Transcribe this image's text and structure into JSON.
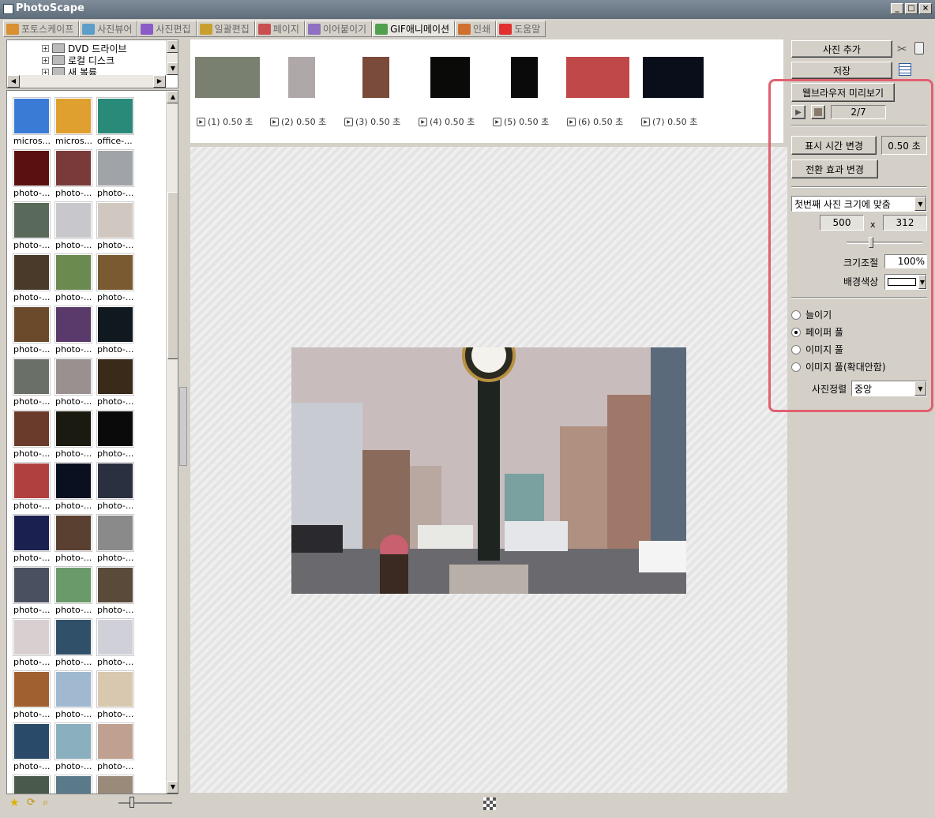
{
  "window": {
    "title": "PhotoScape"
  },
  "tabs": [
    {
      "label": "포토스케이프",
      "color": "#d89030"
    },
    {
      "label": "사진뷰어",
      "color": "#5c9ec8"
    },
    {
      "label": "사진편집",
      "color": "#8a5cc8"
    },
    {
      "label": "일괄편집",
      "color": "#c8a030"
    },
    {
      "label": "페이지",
      "color": "#c85050"
    },
    {
      "label": "이어붙이기",
      "color": "#9070c0"
    },
    {
      "label": "GIF애니메이션",
      "color": "#50a050"
    },
    {
      "label": "인쇄",
      "color": "#d07030"
    },
    {
      "label": "도움말",
      "color": "#e03030"
    }
  ],
  "tree": {
    "items": [
      "DVD 드라이브",
      "로컬 디스크",
      "새 볼륨"
    ]
  },
  "thumbnails": [
    {
      "cap": "micros...",
      "c": "#3a7bd5"
    },
    {
      "cap": "micros...",
      "c": "#e0a030"
    },
    {
      "cap": "office-...",
      "c": "#2a8a7a"
    },
    {
      "cap": "photo-...",
      "c": "#5a1010"
    },
    {
      "cap": "photo-...",
      "c": "#7a3a3a"
    },
    {
      "cap": "photo-...",
      "c": "#a0a4a8"
    },
    {
      "cap": "photo-...",
      "c": "#5a6a5a"
    },
    {
      "cap": "photo-...",
      "c": "#c8c8cc"
    },
    {
      "cap": "photo-...",
      "c": "#d0c8c0"
    },
    {
      "cap": "photo-...",
      "c": "#4a3a2a"
    },
    {
      "cap": "photo-...",
      "c": "#6a8a50"
    },
    {
      "cap": "photo-...",
      "c": "#7a5a30"
    },
    {
      "cap": "photo-...",
      "c": "#6a4a2a"
    },
    {
      "cap": "photo-...",
      "c": "#5a3a6a"
    },
    {
      "cap": "photo-...",
      "c": "#101820"
    },
    {
      "cap": "photo-...",
      "c": "#6a7068"
    },
    {
      "cap": "photo-...",
      "c": "#9a9090"
    },
    {
      "cap": "photo-...",
      "c": "#3a2a1a"
    },
    {
      "cap": "photo-...",
      "c": "#6a3a2a"
    },
    {
      "cap": "photo-...",
      "c": "#1a1a10"
    },
    {
      "cap": "photo-...",
      "c": "#0a0a0a"
    },
    {
      "cap": "photo-...",
      "c": "#b04040"
    },
    {
      "cap": "photo-...",
      "c": "#0a1020"
    },
    {
      "cap": "photo-...",
      "c": "#2a3040"
    },
    {
      "cap": "photo-...",
      "c": "#1a2050"
    },
    {
      "cap": "photo-...",
      "c": "#5a4030"
    },
    {
      "cap": "photo-...",
      "c": "#8a8a8a"
    },
    {
      "cap": "photo-...",
      "c": "#4a5060"
    },
    {
      "cap": "photo-...",
      "c": "#6a9a6a"
    },
    {
      "cap": "photo-...",
      "c": "#5a4a3a"
    },
    {
      "cap": "photo-...",
      "c": "#d8d0d0"
    },
    {
      "cap": "photo-...",
      "c": "#30506a"
    },
    {
      "cap": "photo-...",
      "c": "#d0d0d8"
    },
    {
      "cap": "photo-...",
      "c": "#a06030"
    },
    {
      "cap": "photo-...",
      "c": "#a0b8d0"
    },
    {
      "cap": "photo-...",
      "c": "#d8c8b0"
    },
    {
      "cap": "photo-...",
      "c": "#2a4a6a"
    },
    {
      "cap": "photo-...",
      "c": "#8ab0c0"
    },
    {
      "cap": "photo-...",
      "c": "#c0a090"
    },
    {
      "cap": "",
      "c": "#4a5a4a"
    },
    {
      "cap": "",
      "c": "#5a7a8a"
    },
    {
      "cap": "",
      "c": "#9a8a7a"
    }
  ],
  "frames": [
    {
      "label": "(1) 0.50 초",
      "c": "#7a8070"
    },
    {
      "label": "(2) 0.50 초",
      "c": "#b0a8a8"
    },
    {
      "label": "(3) 0.50 초",
      "c": "#7a4a3a"
    },
    {
      "label": "(4) 0.50 초",
      "c": "#0a0a08"
    },
    {
      "label": "(5) 0.50 초",
      "c": "#0a0a0a"
    },
    {
      "label": "(6) 0.50 초",
      "c": "#c04848"
    },
    {
      "label": "(7) 0.50 초",
      "c": "#0a0e1a"
    }
  ],
  "right_panel": {
    "add_photo": "사진 추가",
    "save": "저장",
    "browser_preview": "웹브라우저 미리보기",
    "frame_counter": "2/7",
    "change_time": "표시 시간 변경",
    "time_value": "0.50 초",
    "change_effect": "전환 효과 변경",
    "size_mode": "첫번째 사진 크기에 맞춤",
    "width": "500",
    "times": "x",
    "height": "312",
    "scale_label": "크기조절",
    "scale_value": "100%",
    "bg_color_label": "배경색상",
    "radio_options": [
      "늘이기",
      "페이퍼 풀",
      "이미지 풀",
      "이미지 풀(확대안함)"
    ],
    "selected_radio": 1,
    "align_label": "사진정렬",
    "align_value": "중앙"
  },
  "colors": {
    "highlight": "#e06070"
  }
}
